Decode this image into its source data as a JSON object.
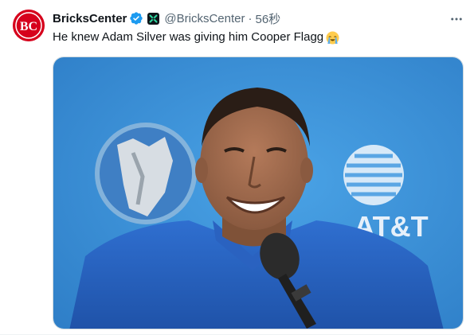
{
  "tweet": {
    "avatar_icon": "bricks-center-logo-icon",
    "avatar_text": "BC",
    "display_name": "BricksCenter",
    "verified_icon": "verified-badge-icon",
    "affiliation_icon": "affiliate-badge-icon",
    "handle": "@BricksCenter",
    "separator": "·",
    "timestamp": "56秒",
    "more_icon": "more-options-icon",
    "text": "He knew Adam Silver was giving him Cooper Flagg",
    "emoji_icon": "loudly-crying-face-icon",
    "image": {
      "logo_brand_text": "AT&T",
      "microphone_icon": "microphone-icon"
    }
  },
  "colors": {
    "brand_red": "#d6001c",
    "verified_blue": "#1d9bf0",
    "muted_text": "#536471",
    "backdrop_blue": "#3a8fd6"
  }
}
